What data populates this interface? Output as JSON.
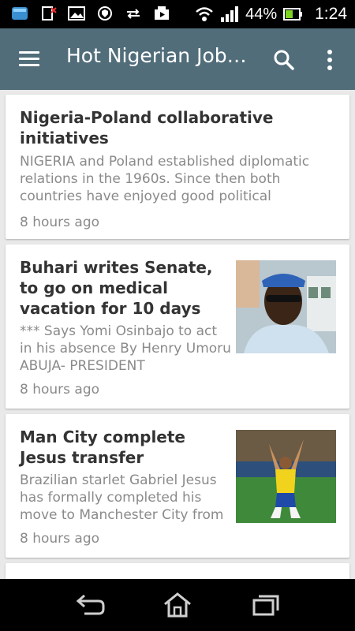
{
  "status_bar": {
    "battery": "44%",
    "time": "1:24"
  },
  "app_bar": {
    "title": "Hot Nigerian Job…"
  },
  "articles": [
    {
      "title": "Nigeria-Poland collaborative initiatives",
      "snippet": "NIGERIA and Poland established diplomatic relations in the 1960s. Since then both countries have enjoyed good political",
      "time": "8 hours ago"
    },
    {
      "title": "Buhari writes Senate, to go on medical vacation for 10 days",
      "snippet": "*** Says Yomi Osinbajo to act in his absence By Henry Umoru ABUJA- PRESIDENT",
      "time": "8 hours ago"
    },
    {
      "title": "Man City complete Jesus transfer",
      "snippet": "Brazilian starlet Gabriel Jesus has formally completed his move to Manchester City from",
      "time": "8 hours ago"
    }
  ],
  "colors": {
    "app_bar": "#526d7a",
    "background": "#e9e9e9"
  }
}
